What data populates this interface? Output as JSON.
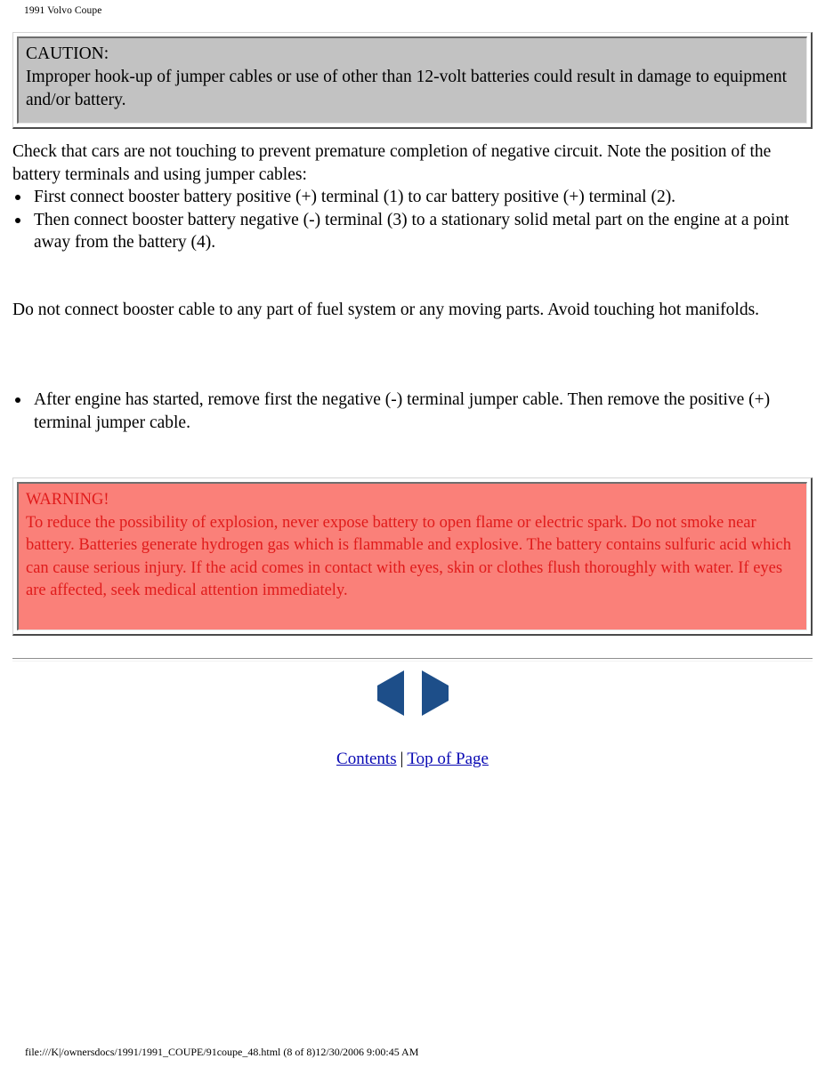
{
  "header": {
    "running_head": "1991 Volvo Coupe"
  },
  "caution": {
    "title": "CAUTION:",
    "body": "Improper hook-up of jumper cables or use of other than 12-volt batteries could result in damage to equipment and/or battery.",
    "background_color": "#C2C2C2",
    "text_color": "#000000"
  },
  "content": {
    "intro_paragraph": "Check that cars are not touching to prevent premature completion of negative circuit. Note the position of the battery terminals and using jumper cables:",
    "bullets_group_1": [
      "First connect booster battery positive (+) terminal (1) to car battery positive (+) terminal (2).",
      "Then connect booster battery negative (-) terminal (3) to a stationary solid metal part on the engine at a point away from the battery (4)."
    ],
    "fuel_paragraph": "Do not connect booster cable to any part of fuel system or any moving parts. Avoid touching hot manifolds.",
    "bullets_group_2": [
      "After engine has started, remove first the negative (-) terminal jumper cable. Then remove the positive (+) terminal jumper cable."
    ]
  },
  "warning": {
    "title": "WARNING!",
    "body": "To reduce the possibility of explosion, never expose battery to open flame or electric spark. Do not smoke near battery. Batteries generate hydrogen gas which is flammable and explosive. The battery contains sulfuric acid which can cause serious injury. If the acid comes in contact with eyes, skin or clothes flush thoroughly with water. If eyes are affected, seek medical attention immediately.",
    "background_color": "#FA8079",
    "text_color": "#E01B1B"
  },
  "navigation": {
    "previous_label": "previous-page-arrow",
    "next_label": "next-page-arrow",
    "arrow_color": "#1D4E89",
    "links": {
      "contents": "Contents",
      "separator": "|",
      "top_of_page": "Top of Page",
      "link_color": "#0A0AB4"
    }
  },
  "print_footer": {
    "text": "file:///K|/ownersdocs/1991/1991_COUPE/91coupe_48.html (8 of 8)12/30/2006 9:00:45 AM"
  }
}
